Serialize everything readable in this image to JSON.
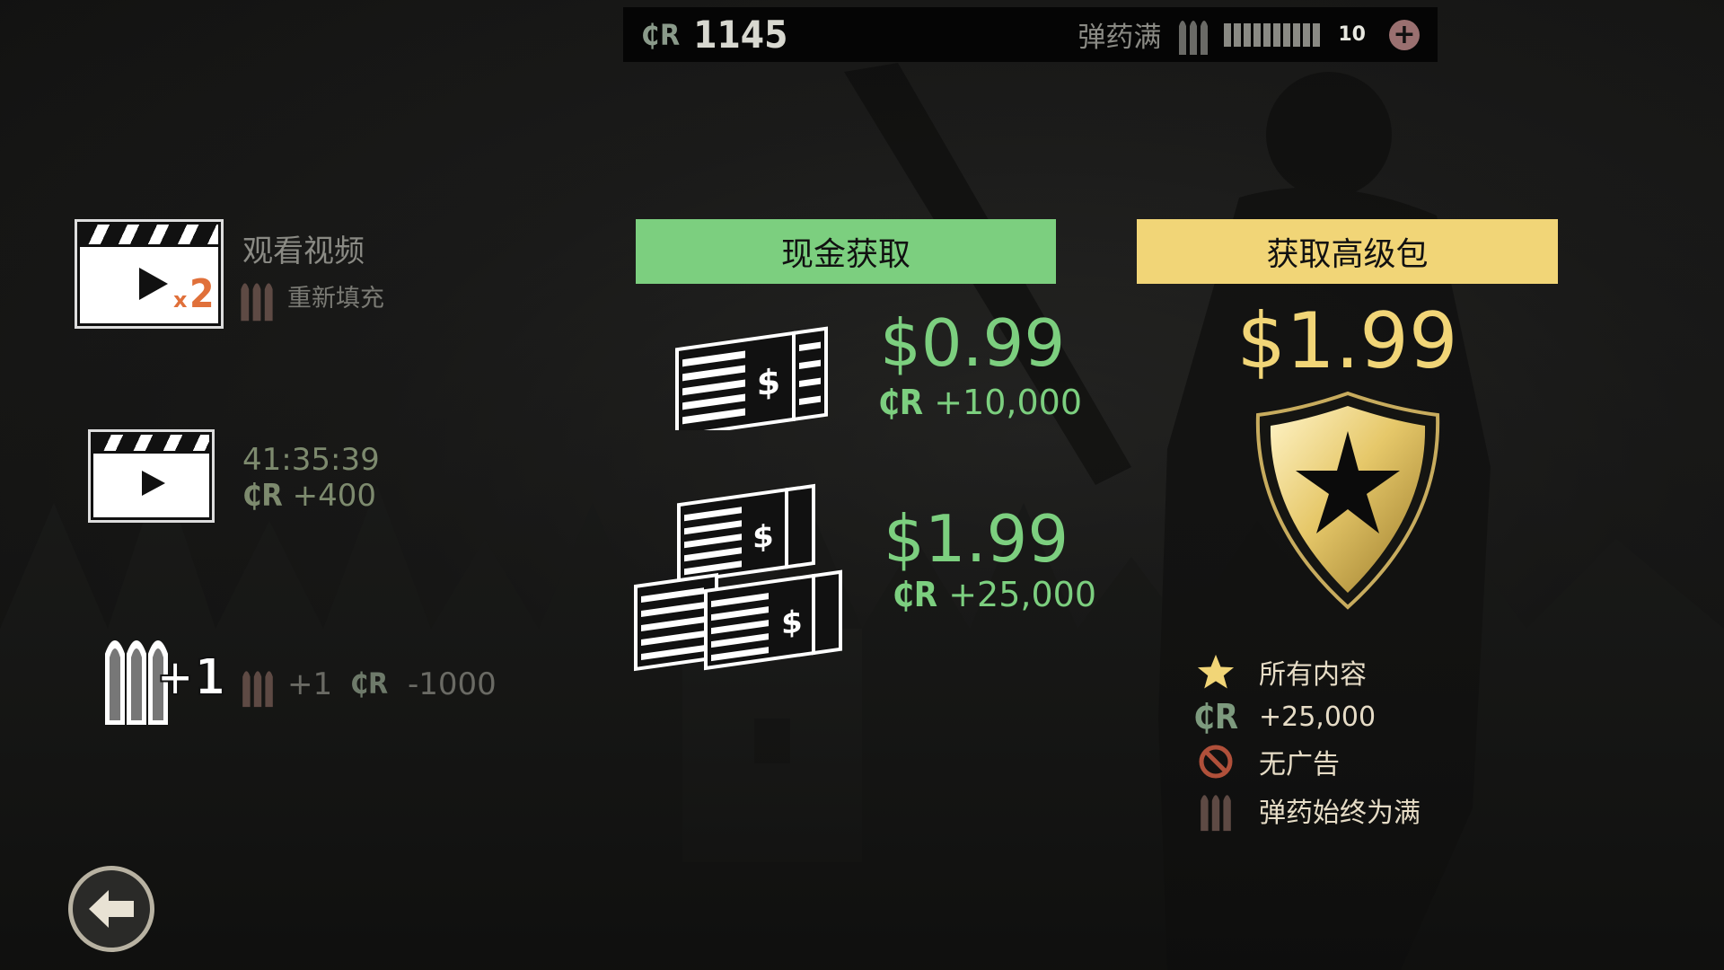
{
  "topbar": {
    "currency_symbol": "₵R",
    "credits": "1145",
    "ammo_status": "弹药满",
    "ammo_count": "10",
    "add_icon": "plus-circle-icon"
  },
  "watch_video": {
    "title": "观看视频",
    "multiplier": "x",
    "multiplier_num": "2",
    "refill_label": "重新填充",
    "icon": "clapperboard-icon"
  },
  "free_video": {
    "timer": "41:35:39",
    "currency_symbol": "₵R",
    "reward": "+400",
    "icon": "clapperboard-icon"
  },
  "buy_ammo": {
    "icon_label": "+1",
    "ammo_plus": "+1",
    "currency_symbol": "₵R",
    "cost": "-1000"
  },
  "cash_offer": {
    "header": "现金获取",
    "offers": [
      {
        "price": "$0.99",
        "currency_symbol": "₵R",
        "reward": "+10,000"
      },
      {
        "price": "$1.99",
        "currency_symbol": "₵R",
        "reward": "+25,000"
      }
    ]
  },
  "premium": {
    "header": "获取高级包",
    "price": "$1.99",
    "features": [
      {
        "icon": "star-icon",
        "text": "所有内容"
      },
      {
        "icon": "credits-icon",
        "icon_text": "₵R",
        "text": "+25,000"
      },
      {
        "icon": "no-ads-icon",
        "text": "无广告"
      },
      {
        "icon": "ammo-icon",
        "text": "弹药始终为满"
      }
    ]
  },
  "back_icon": "back-arrow-icon",
  "colors": {
    "cash_green": "#7ccf7f",
    "premium_gold": "#f1d577",
    "multiplier_orange": "#e0703a"
  }
}
